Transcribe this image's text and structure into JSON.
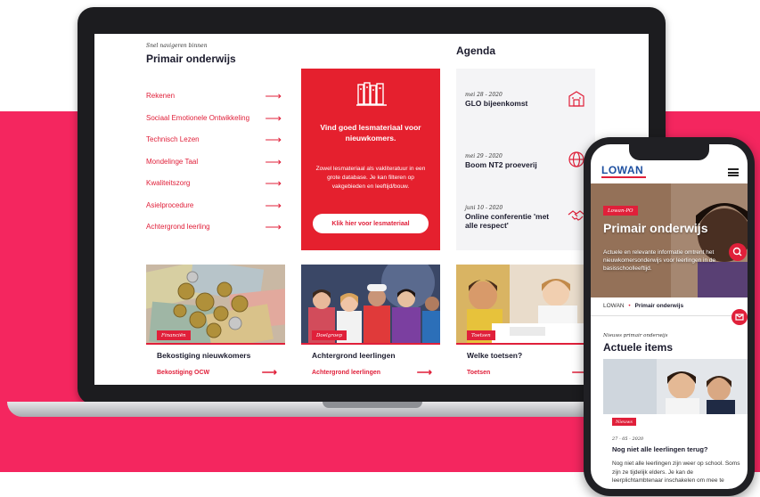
{
  "desktop": {
    "nav": {
      "eyebrow": "Snel navigeren binnen",
      "title": "Primair onderwijs",
      "items": [
        {
          "label": "Rekenen"
        },
        {
          "label": "Sociaal Emotionele Ontwikkeling"
        },
        {
          "label": "Technisch Lezen"
        },
        {
          "label": "Mondelinge Taal"
        },
        {
          "label": "Kwaliteitszorg"
        },
        {
          "label": "Asielprocedure"
        },
        {
          "label": "Achtergrond leerling"
        }
      ]
    },
    "promo": {
      "icon": "books-icon",
      "heading": "Vind goed lesmateriaal voor nieuwkomers.",
      "body": "Zowel lesmateriaal als vakliteratuur in een grote database. Je kan filteren op vakgebieden en leeftijd/bouw.",
      "button": "Klik hier voor lesmateriaal"
    },
    "agenda": {
      "title": "Agenda",
      "events": [
        {
          "date": "mei 28 - 2020",
          "title": "GLO bijeenkomst",
          "icon": "building-icon"
        },
        {
          "date": "mei 29 - 2020",
          "title": "Boom NT2 proeverij",
          "icon": "globe-icon"
        },
        {
          "date": "juni 10 - 2020",
          "title": "Online conferentie 'met alle respect'",
          "icon": "handshake-icon"
        }
      ]
    },
    "cards": [
      {
        "tag": "Financiën",
        "title": "Bekostiging nieuwkomers",
        "link": "Bekostiging OCW"
      },
      {
        "tag": "Doelgroep",
        "title": "Achtergrond leerlingen",
        "link": "Achtergrond leerlingen"
      },
      {
        "tag": "Toetsen",
        "title": "Welke toetsen?",
        "link": "Toetsen"
      }
    ],
    "arrow": "⟶"
  },
  "mobile": {
    "logo": "LOWAN",
    "hero": {
      "tag": "Lowan-PO",
      "title": "Primair onderwijs",
      "text": "Actuele en relevante informatie omtrent het nieuwkomersonderwijs voor leerlingen in de basisschoolleeftijd."
    },
    "breadcrumb": {
      "root": "LOWAN",
      "separator": "•",
      "current": "Primair onderwijs"
    },
    "news": {
      "eyebrow": "Nieuws primair onderwijs",
      "title": "Actuele items",
      "tag": "Nieuws",
      "date": "27 - 05 - 2020",
      "headline": "Nog niet alle leerlingen terug?",
      "body": "Nog niet alle leerlingen zijn weer op school. Soms zijn ze tijdelijk elders. Je kan de leerplichtambtenaar inschakelen om mee te"
    }
  },
  "colors": {
    "accent": "#e0203a",
    "pink": "#f4265f",
    "brand_blue": "#1d4fa0"
  }
}
